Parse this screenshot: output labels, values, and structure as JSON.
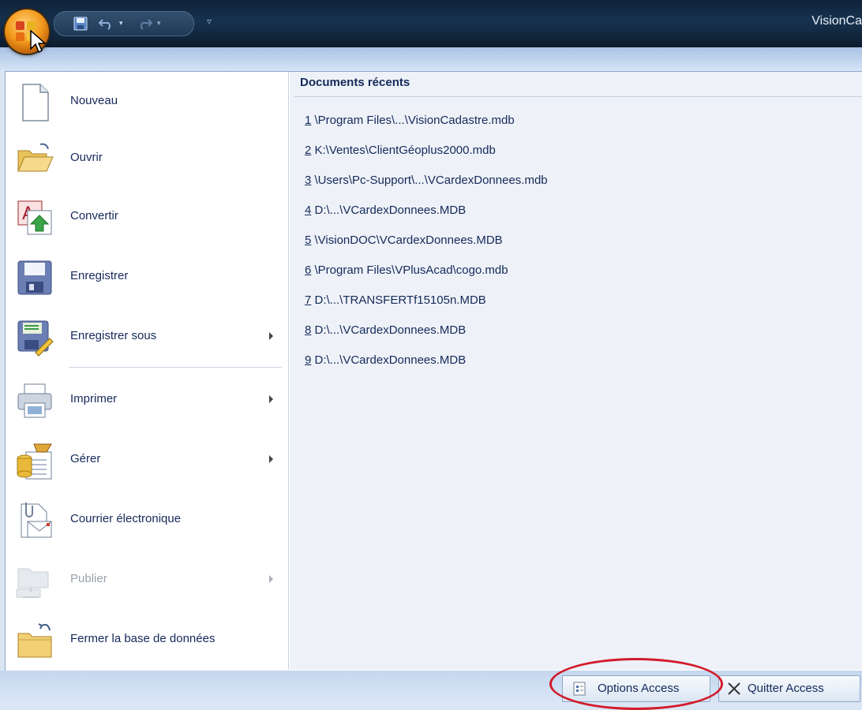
{
  "window": {
    "title": "VisionCa"
  },
  "qat": {
    "customize_glyph": "▿"
  },
  "menu": {
    "items": [
      {
        "label": "Nouveau",
        "icon": "new-document-icon",
        "has_submenu": false,
        "enabled": true
      },
      {
        "label": "Ouvrir",
        "icon": "open-folder-icon",
        "has_submenu": false,
        "enabled": true
      },
      {
        "label": "Convertir",
        "icon": "convert-database-icon",
        "has_submenu": false,
        "enabled": true
      },
      {
        "label": "Enregistrer",
        "icon": "save-disk-icon",
        "has_submenu": false,
        "enabled": true
      },
      {
        "label": "Enregistrer sous",
        "icon": "save-as-icon",
        "has_submenu": true,
        "enabled": true
      },
      {
        "label": "Imprimer",
        "icon": "printer-icon",
        "has_submenu": true,
        "enabled": true
      },
      {
        "label": "Gérer",
        "icon": "manage-database-icon",
        "has_submenu": true,
        "enabled": true
      },
      {
        "label": "Courrier électronique",
        "icon": "email-icon",
        "has_submenu": false,
        "enabled": true
      },
      {
        "label": "Publier",
        "icon": "publish-server-icon",
        "has_submenu": true,
        "enabled": false
      },
      {
        "label": "Fermer la base de données",
        "icon": "close-database-folder-icon",
        "has_submenu": false,
        "enabled": true
      }
    ]
  },
  "recent": {
    "title": "Documents récents",
    "items": [
      {
        "num": "1",
        "path": " \\Program Files\\...\\VisionCadastre.mdb"
      },
      {
        "num": "2",
        "path": " K:\\Ventes\\ClientGéoplus2000.mdb"
      },
      {
        "num": "3",
        "path": " \\Users\\Pc-Support\\...\\VCardexDonnees.mdb"
      },
      {
        "num": "4",
        "path": " D:\\...\\VCardexDonnees.MDB"
      },
      {
        "num": "5",
        "path": " \\VisionDOC\\VCardexDonnees.MDB"
      },
      {
        "num": "6",
        "path": " \\Program Files\\VPlusAcad\\cogo.mdb"
      },
      {
        "num": "7",
        "path": " D:\\...\\TRANSFERTf15105n.MDB"
      },
      {
        "num": "8",
        "path": " D:\\...\\VCardexDonnees.MDB"
      },
      {
        "num": "9",
        "path": " D:\\...\\VCardexDonnees.MDB"
      }
    ]
  },
  "bottom": {
    "options_label": "Options Access",
    "quit_label": "Quitter Access"
  },
  "colors": {
    "highlight": "#d21c2c",
    "accent": "#f39a1d",
    "text": "#15295a"
  }
}
